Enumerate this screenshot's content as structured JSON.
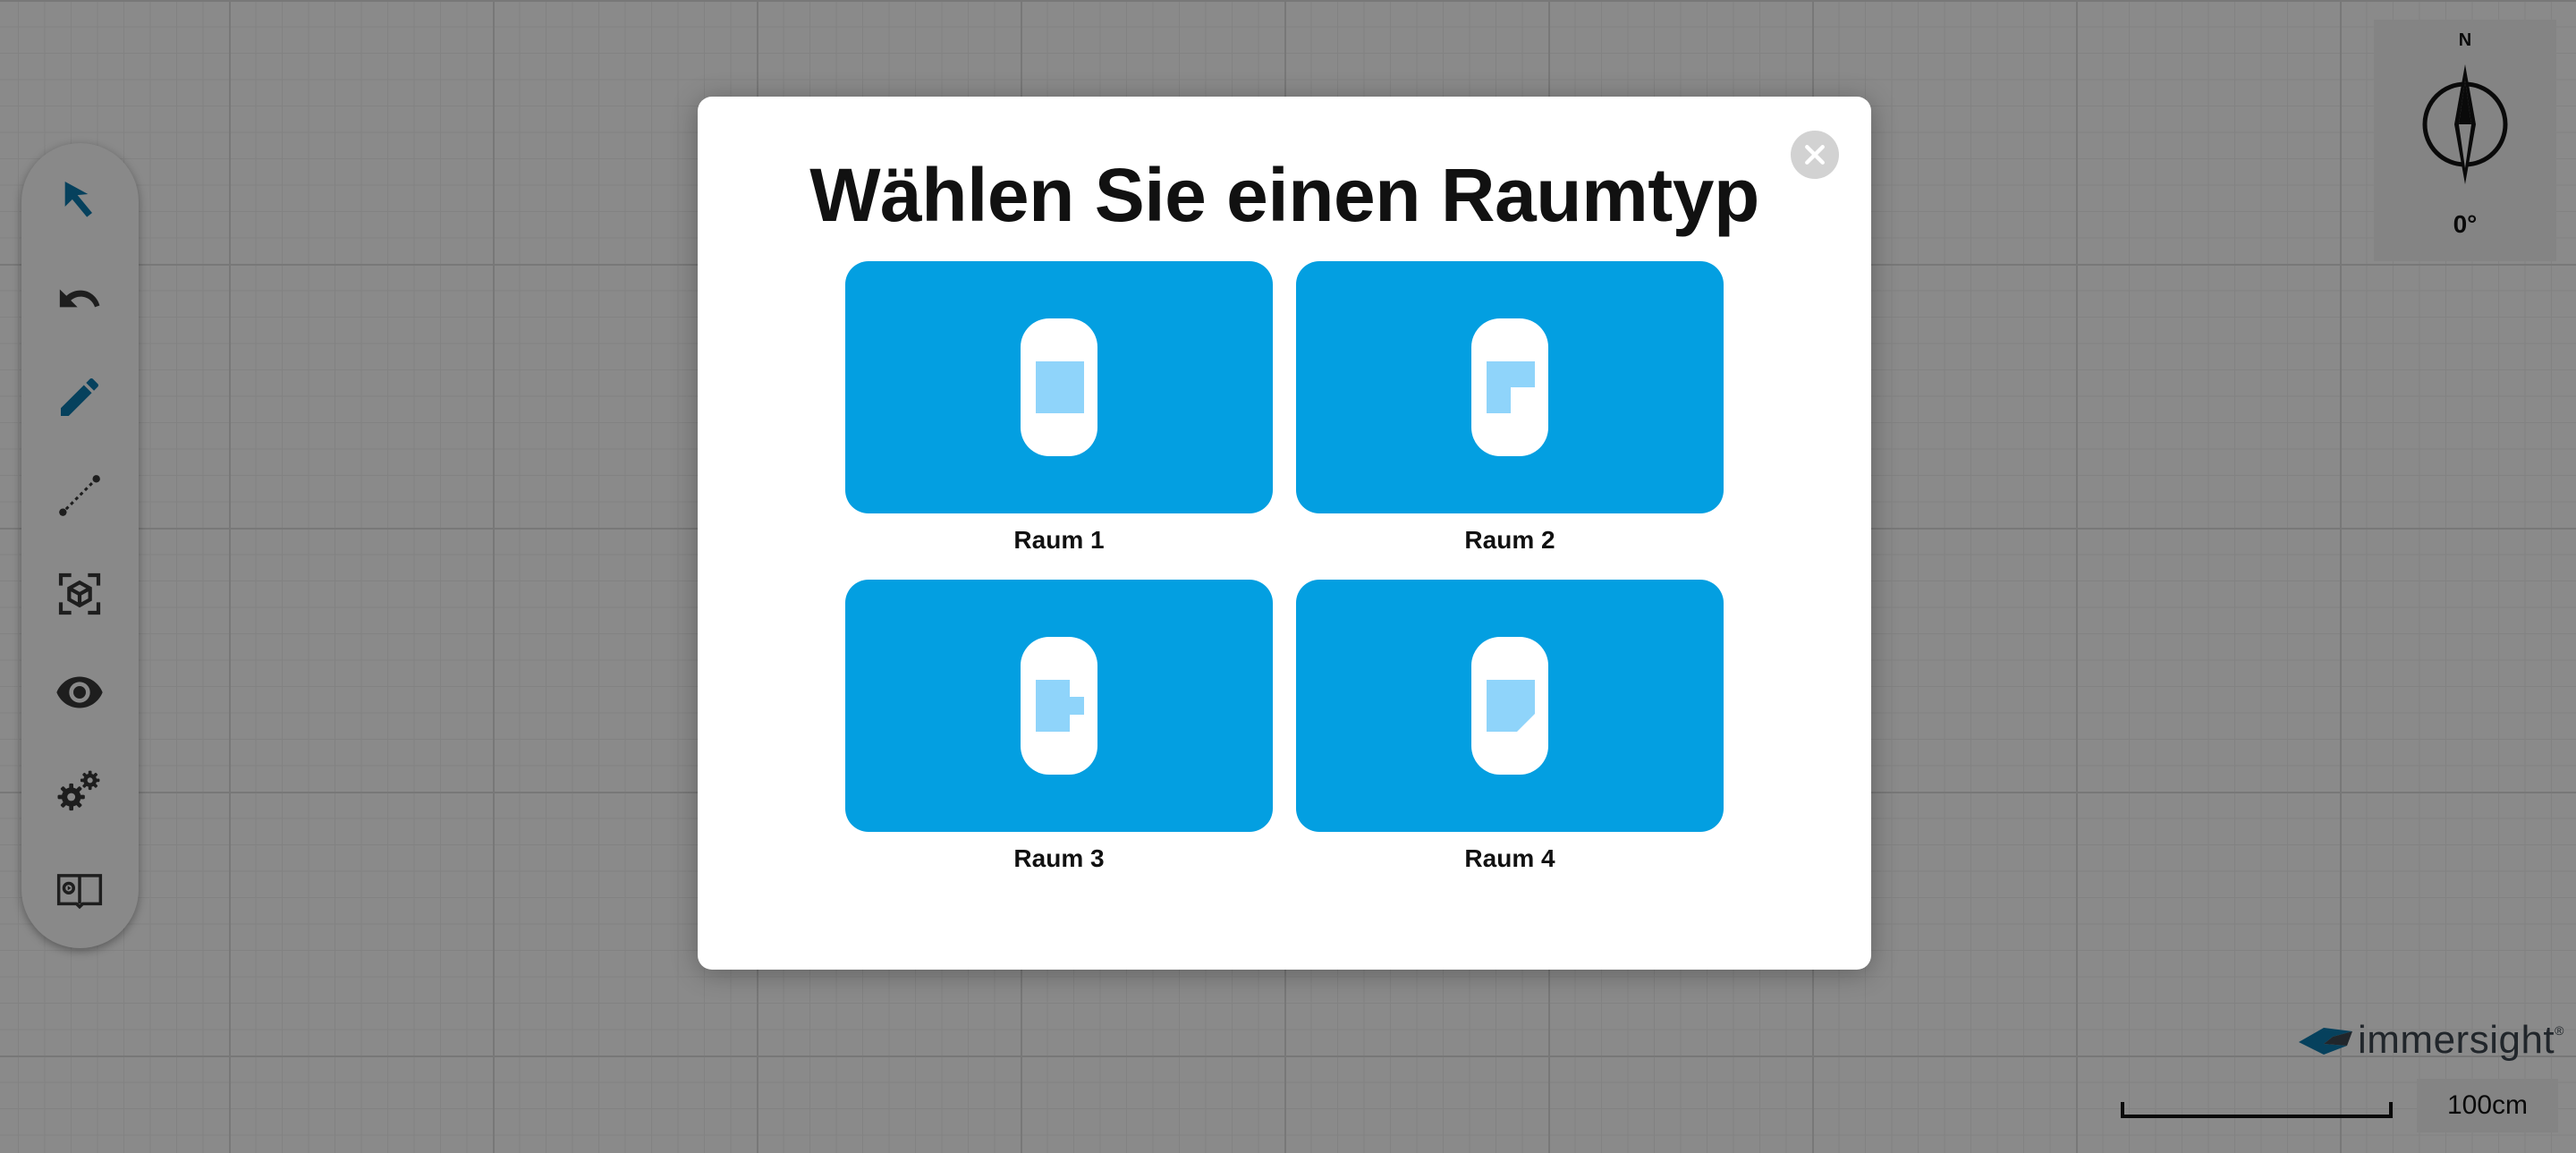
{
  "canvas": {
    "background": "#e6e6e6"
  },
  "toolbar": {
    "tools": [
      {
        "name": "select",
        "icon": "cursor-arrow-icon"
      },
      {
        "name": "undo",
        "icon": "undo-icon"
      },
      {
        "name": "draw",
        "icon": "pencil-icon"
      },
      {
        "name": "measure",
        "icon": "dotted-line-icon"
      },
      {
        "name": "3d-view",
        "icon": "3d-cube-icon"
      },
      {
        "name": "visibility",
        "icon": "eye-icon"
      },
      {
        "name": "settings",
        "icon": "gears-icon"
      },
      {
        "name": "catalog",
        "icon": "book-icon"
      }
    ]
  },
  "compass": {
    "north_label": "N",
    "rotation": "0°"
  },
  "brand": {
    "name": "immersight",
    "registered": "®"
  },
  "scale": {
    "label": "100cm"
  },
  "modal": {
    "title": "Wählen Sie einen Raumtyp",
    "close_icon": "close-icon",
    "accent_color": "#039fe1",
    "rooms": [
      {
        "label": "Raum 1",
        "shape": "square"
      },
      {
        "label": "Raum 2",
        "shape": "l-shape"
      },
      {
        "label": "Raum 3",
        "shape": "t-shape"
      },
      {
        "label": "Raum 4",
        "shape": "cut-corner"
      }
    ]
  }
}
